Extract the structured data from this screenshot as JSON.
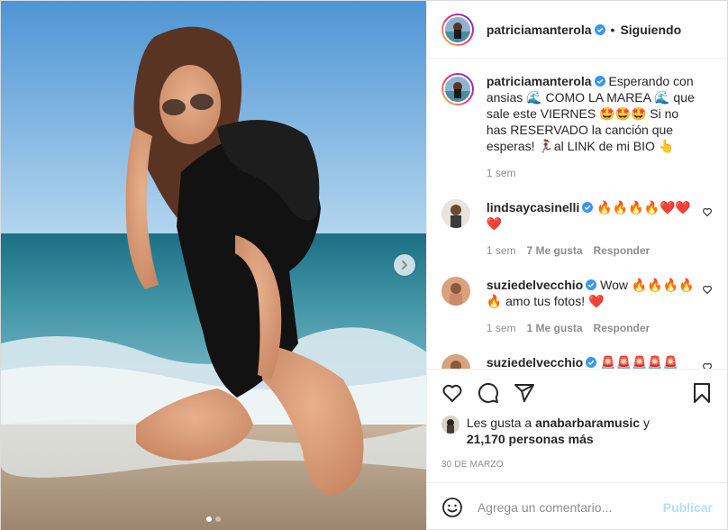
{
  "post": {
    "author": "patriciamanterola",
    "follow_separator": "•",
    "follow_status": "Siguiendo",
    "carousel": {
      "slides": 2,
      "active_slide": 1
    }
  },
  "caption": {
    "username": "patriciamanterola",
    "text": "Esperando con ansias 🌊 COMO LA MAREA 🌊 que sale este VIERNES 🤩🤩🤩 Si no has RESERVADO la canción que esperas! 🏃‍♀️al LINK de mi BIO 👆",
    "time": "1 sem"
  },
  "comments": [
    {
      "username": "lindsaycasinelli",
      "text": "🔥🔥🔥🔥❤️❤️❤️",
      "time": "1 sem",
      "likes": "7 Me gusta",
      "reply": "Responder"
    },
    {
      "username": "suziedelvecchio",
      "text": "Wow 🔥🔥🔥🔥🔥 amo tus fotos! ❤️",
      "time": "1 sem",
      "likes": "1 Me gusta",
      "reply": "Responder"
    },
    {
      "username": "suziedelvecchio",
      "text": "🚨🚨🚨🚨🚨"
    }
  ],
  "likes": {
    "prefix": "Les gusta a",
    "user": "anabarbaramusic",
    "conj": "y",
    "others": "21,170 personas más"
  },
  "date": "30 DE MARZO",
  "add_comment": {
    "placeholder": "Agrega un comentario...",
    "publish": "Publicar"
  },
  "icons": [
    "verified-badge-icon",
    "chevron-right-icon",
    "heart-icon",
    "comment-icon",
    "share-icon",
    "bookmark-icon",
    "emoji-icon",
    "small-heart-icon"
  ],
  "colors": {
    "verified": "#3897f0",
    "publish_disabled": "#b2dffc",
    "muted": "#8e8e8e",
    "text": "#262626",
    "like_red": "#ed4956"
  }
}
